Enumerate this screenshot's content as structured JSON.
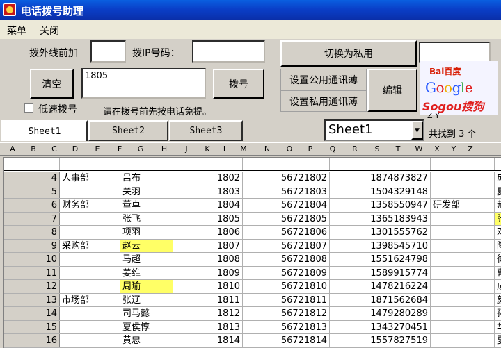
{
  "window": {
    "title": "电话拨号助理"
  },
  "menu": [
    "菜单",
    "关闭"
  ],
  "dialer": {
    "outside_line_label": "拨外线前加",
    "outside_line_value": "",
    "ip_label": "拨IP号码：",
    "ip_value": "",
    "switch_button": "切换为私用",
    "clear_button": "清空",
    "number_value": "1805",
    "dial_button": "拨号",
    "set_public_button": "设置公用通讯薄",
    "set_private_button": "设置私用通讯薄",
    "edit_button": "编辑",
    "slow_dial_label": "低速拨号",
    "slow_dial_checked": false,
    "hint": "请在拨号前先按电话免提。",
    "search_box_value": ""
  },
  "search_logos": {
    "baidu": "Bai百度",
    "google": [
      "G",
      "o",
      "o",
      "g",
      "l",
      "e"
    ],
    "sogou": "Sogou搜狗",
    "google_colors": [
      "#2255ff",
      "#e02020",
      "#f0b000",
      "#2255ff",
      "#20a030",
      "#e02020"
    ]
  },
  "sheets": {
    "tabs": [
      "Sheet1",
      "Sheet2",
      "Sheet3"
    ],
    "selected": "Sheet1",
    "found_prefix": "Z Y",
    "found_text": "共找到 3 个"
  },
  "column_letters": [
    "A",
    "B",
    "C",
    "D",
    "E",
    "F",
    "G",
    "H",
    "J",
    "K",
    "L",
    "M",
    "N",
    "O",
    "P",
    "Q",
    "R",
    "S",
    "T",
    "W",
    "X",
    "Y",
    "Z"
  ],
  "rows": [
    {
      "n": "4",
      "dept": "人事部",
      "name": "吕布",
      "ext": "1802",
      "tel": "56721802",
      "mobile": "1874873827",
      "dept2": "",
      "extra": "成",
      "hl": false
    },
    {
      "n": "5",
      "dept": "",
      "name": "关羽",
      "ext": "1803",
      "tel": "56721803",
      "mobile": "1504329148",
      "dept2": "",
      "extra": "夏",
      "hl": false
    },
    {
      "n": "6",
      "dept": "财务部",
      "name": "董卓",
      "ext": "1804",
      "tel": "56721804",
      "mobile": "1358550947",
      "dept2": "研发部",
      "extra": "郝",
      "hl": false
    },
    {
      "n": "7",
      "dept": "",
      "name": "张飞",
      "ext": "1805",
      "tel": "56721805",
      "mobile": "1365183943",
      "dept2": "",
      "extra": "张",
      "hl": false
    },
    {
      "n": "8",
      "dept": "",
      "name": "项羽",
      "ext": "1806",
      "tel": "56721806",
      "mobile": "1301555762",
      "dept2": "",
      "extra": "邓",
      "hl": false
    },
    {
      "n": "9",
      "dept": "采购部",
      "name": "赵云",
      "ext": "1807",
      "tel": "56721807",
      "mobile": "1398545710",
      "dept2": "",
      "extra": "陶",
      "hl": true
    },
    {
      "n": "10",
      "dept": "",
      "name": "马超",
      "ext": "1808",
      "tel": "56721808",
      "mobile": "1551624798",
      "dept2": "",
      "extra": "徐",
      "hl": false
    },
    {
      "n": "11",
      "dept": "",
      "name": "姜维",
      "ext": "1809",
      "tel": "56721809",
      "mobile": "1589915774",
      "dept2": "",
      "extra": "曹",
      "hl": false
    },
    {
      "n": "12",
      "dept": "",
      "name": "周瑜",
      "ext": "1810",
      "tel": "56721810",
      "mobile": "1478216224",
      "dept2": "",
      "extra": "成",
      "hl": true
    },
    {
      "n": "13",
      "dept": "市场部",
      "name": "张辽",
      "ext": "1811",
      "tel": "56721811",
      "mobile": "1871562684",
      "dept2": "",
      "extra": "颜",
      "hl": false
    },
    {
      "n": "14",
      "dept": "",
      "name": "司马懿",
      "ext": "1812",
      "tel": "56721812",
      "mobile": "1479280289",
      "dept2": "",
      "extra": "孙",
      "hl": false
    },
    {
      "n": "15",
      "dept": "",
      "name": "夏侯惇",
      "ext": "1813",
      "tel": "56721813",
      "mobile": "1343270451",
      "dept2": "",
      "extra": "华",
      "hl": false
    },
    {
      "n": "16",
      "dept": "",
      "name": "黄忠",
      "ext": "1814",
      "tel": "56721814",
      "mobile": "1557827519",
      "dept2": "",
      "extra": "夏",
      "hl": false
    }
  ],
  "colors": {
    "highlight": "#ffff66",
    "titlebar": "#0a3fc8"
  }
}
